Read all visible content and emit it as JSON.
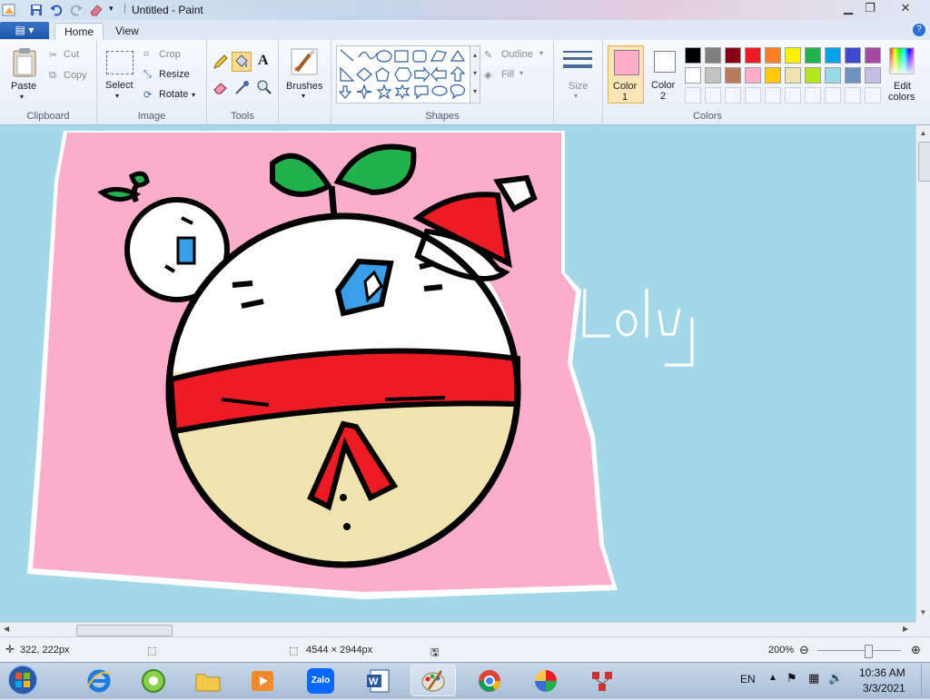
{
  "window": {
    "title": "Untitled - Paint"
  },
  "ribbon": {
    "tabs": [
      "Home",
      "View"
    ],
    "clipboard": {
      "paste": "Paste",
      "cut": "Cut",
      "copy": "Copy",
      "group": "Clipboard"
    },
    "image": {
      "select": "Select",
      "crop": "Crop",
      "resize": "Resize",
      "rotate": "Rotate",
      "group": "Image"
    },
    "tools": {
      "group": "Tools"
    },
    "brushes": {
      "label": "Brushes"
    },
    "shapes": {
      "outline": "Outline",
      "fill": "Fill",
      "group": "Shapes"
    },
    "size": {
      "label": "Size"
    },
    "colors": {
      "color1": "Color",
      "color1_num": "1",
      "color2": "Color",
      "color2_num": "2",
      "color1_value": "#ffaec9",
      "color2_value": "#ffffff",
      "edit": "Edit",
      "edit2": "colors",
      "group": "Colors",
      "palette_row1": [
        "#000000",
        "#7f7f7f",
        "#880015",
        "#ed1c24",
        "#ff7f27",
        "#fff200",
        "#22b14c",
        "#00a2e8",
        "#3f48cc",
        "#a349a4"
      ],
      "palette_row2": [
        "#ffffff",
        "#c3c3c3",
        "#b97a57",
        "#ffaec9",
        "#ffc90e",
        "#efe4b0",
        "#b5e61d",
        "#99d9ea",
        "#7092be",
        "#c8bfe7"
      ]
    }
  },
  "drawing": {
    "signature": "Loly"
  },
  "status": {
    "cursor_pos": "322, 222px",
    "image_size": "4544 × 2944px",
    "zoom": "200%"
  },
  "taskbar": {
    "language": "EN",
    "time": "10:36 AM",
    "date": "3/3/2021",
    "zalo": "Zalo"
  }
}
